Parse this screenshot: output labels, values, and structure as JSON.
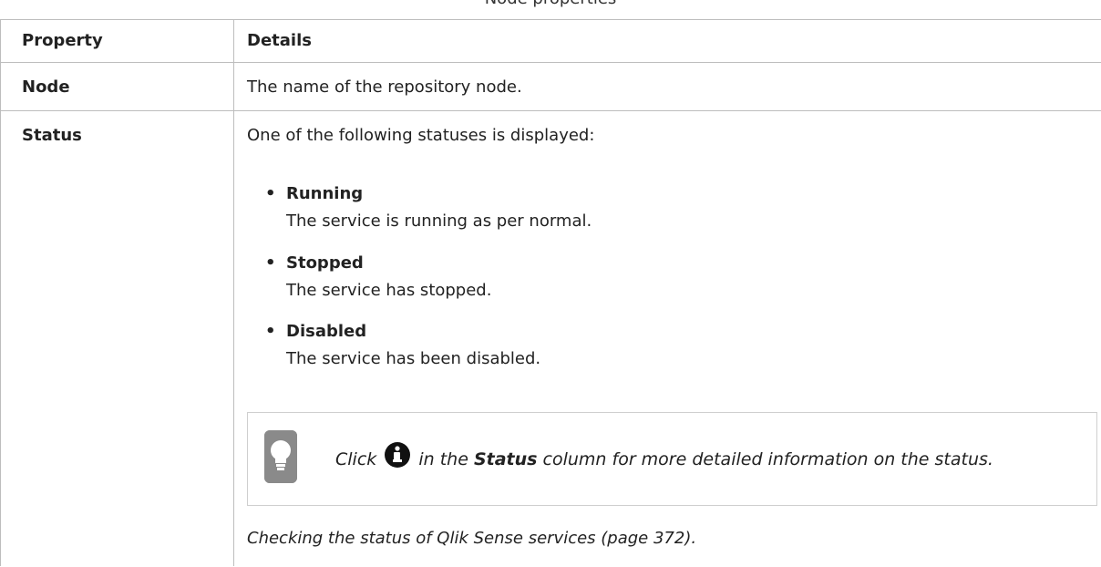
{
  "caption": "Node properties",
  "table": {
    "header": {
      "property": "Property",
      "details": "Details"
    },
    "rows": [
      {
        "property": "Node",
        "details": "The name of the repository node."
      },
      {
        "property": "Status",
        "intro": "One of the following statuses is displayed:",
        "statuses": [
          {
            "name": "Running",
            "description": "The service is running as per normal."
          },
          {
            "name": "Stopped",
            "description": "The service has stopped."
          },
          {
            "name": "Disabled",
            "description": "The service has been disabled."
          }
        ],
        "tip": {
          "before": "Click",
          "after_icon": "in the",
          "bold": "Status",
          "rest": "column for more detailed information on the status."
        },
        "link": "Checking the status of Qlik Sense services (page 372)."
      }
    ]
  },
  "icons": {
    "tip_icon": "lightbulb-icon",
    "info_icon": "info-circle-icon"
  }
}
